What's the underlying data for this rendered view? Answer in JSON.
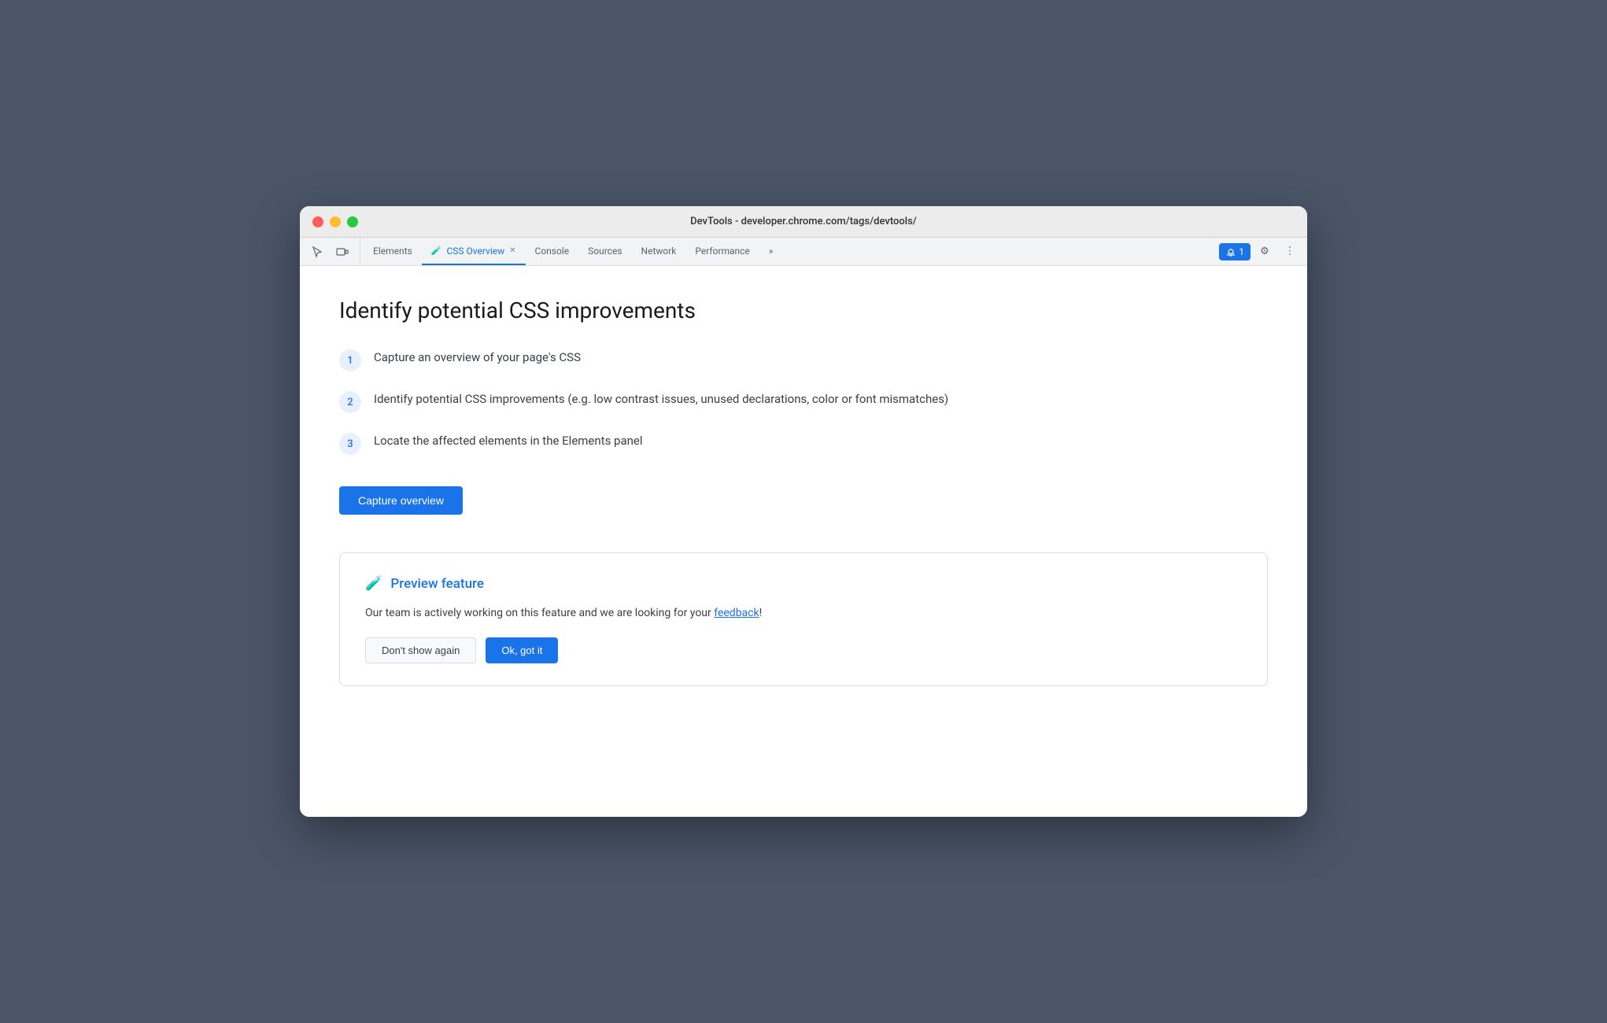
{
  "titlebar": {
    "url": "DevTools - developer.chrome.com/tags/devtools/"
  },
  "tabs": {
    "items": [
      {
        "id": "elements",
        "label": "Elements",
        "active": false
      },
      {
        "id": "css-overview",
        "label": "CSS Overview",
        "active": true,
        "hasFlask": true,
        "hasClose": true
      },
      {
        "id": "console",
        "label": "Console",
        "active": false
      },
      {
        "id": "sources",
        "label": "Sources",
        "active": false
      },
      {
        "id": "network",
        "label": "Network",
        "active": false
      },
      {
        "id": "performance",
        "label": "Performance",
        "active": false
      },
      {
        "id": "more",
        "label": "»",
        "active": false
      }
    ],
    "notification_count": "1",
    "notification_label": "1"
  },
  "main": {
    "title": "Identify potential CSS improvements",
    "steps": [
      {
        "number": "1",
        "text": "Capture an overview of your page's CSS"
      },
      {
        "number": "2",
        "text": "Identify potential CSS improvements (e.g. low contrast issues, unused declarations, color or font mismatches)"
      },
      {
        "number": "3",
        "text": "Locate the affected elements in the Elements panel"
      }
    ],
    "capture_button_label": "Capture overview",
    "preview": {
      "icon_label": "🧪",
      "title": "Preview feature",
      "description_start": "Our team is actively working on this feature and we are looking for your ",
      "feedback_link_text": "feedback",
      "description_end": "!",
      "btn_dismiss": "Don't show again",
      "btn_ok": "Ok, got it"
    }
  },
  "icons": {
    "cursor": "⬡",
    "device": "⬡",
    "gear": "⚙",
    "more_vert": "⋮",
    "flask": "🧪"
  }
}
